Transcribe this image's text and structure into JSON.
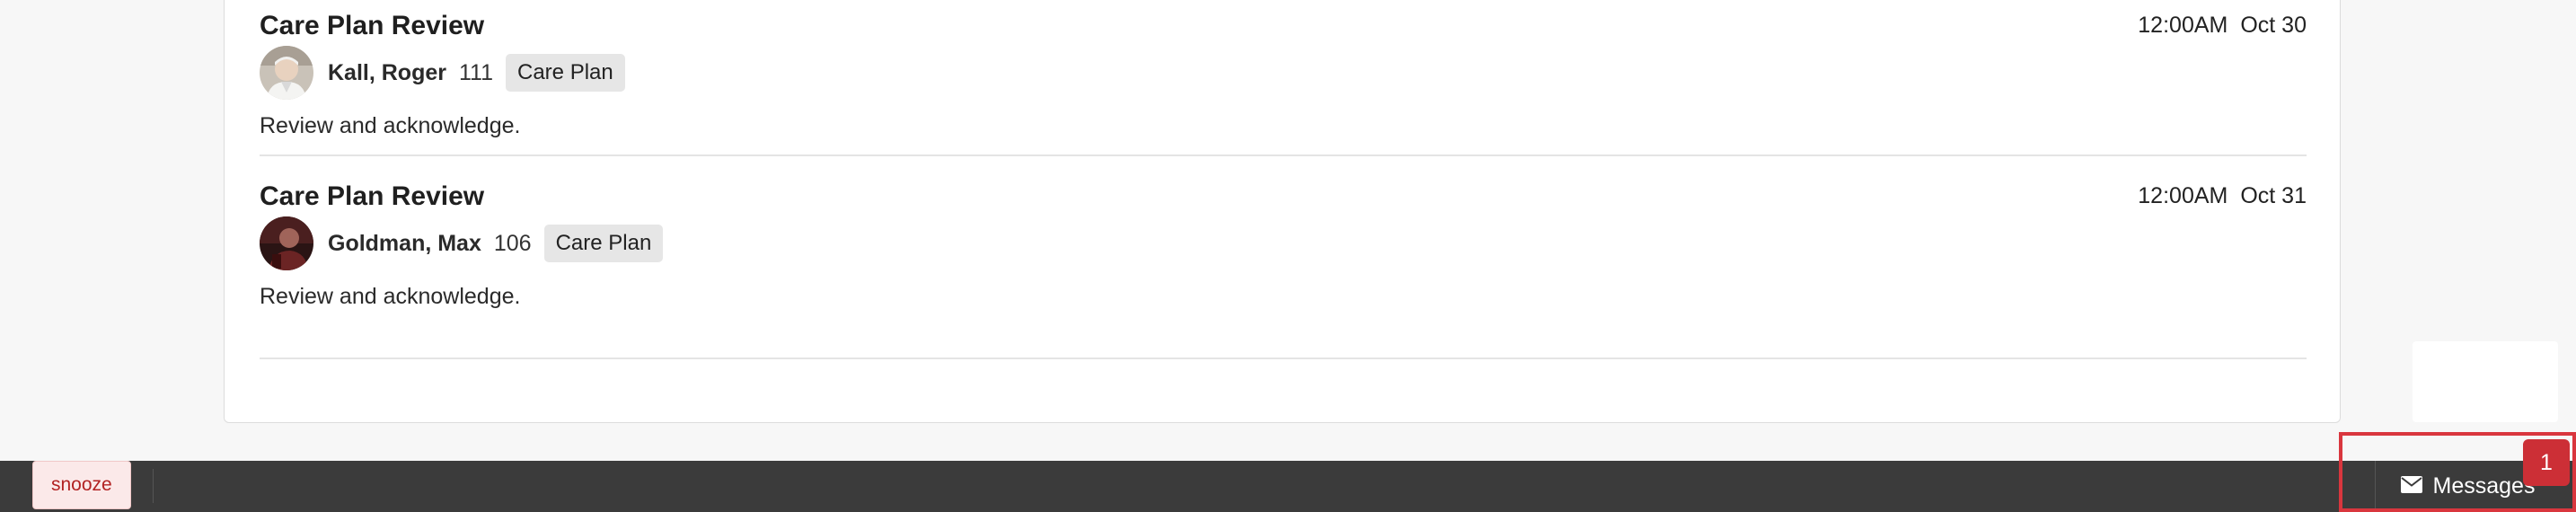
{
  "feed": {
    "items": [
      {
        "title": "Care Plan Review",
        "time": "12:00AM",
        "date": "Oct 30",
        "resident_name": "Kall, Roger",
        "room": "111",
        "tag": "Care Plan",
        "body": "Review and acknowledge."
      },
      {
        "title": "Care Plan Review",
        "time": "12:00AM",
        "date": "Oct 31",
        "resident_name": "Goldman, Max",
        "room": "106",
        "tag": "Care Plan",
        "body": "Review and acknowledge."
      }
    ]
  },
  "bottom_bar": {
    "snooze_label": "snooze",
    "messages_label": "Messages",
    "messages_icon": "envelope-icon",
    "unread_count": "1"
  },
  "colors": {
    "bar_background": "#3b3b3b",
    "badge": "#cc2f36",
    "snooze_text": "#b22222",
    "highlight": "#d9363e"
  }
}
